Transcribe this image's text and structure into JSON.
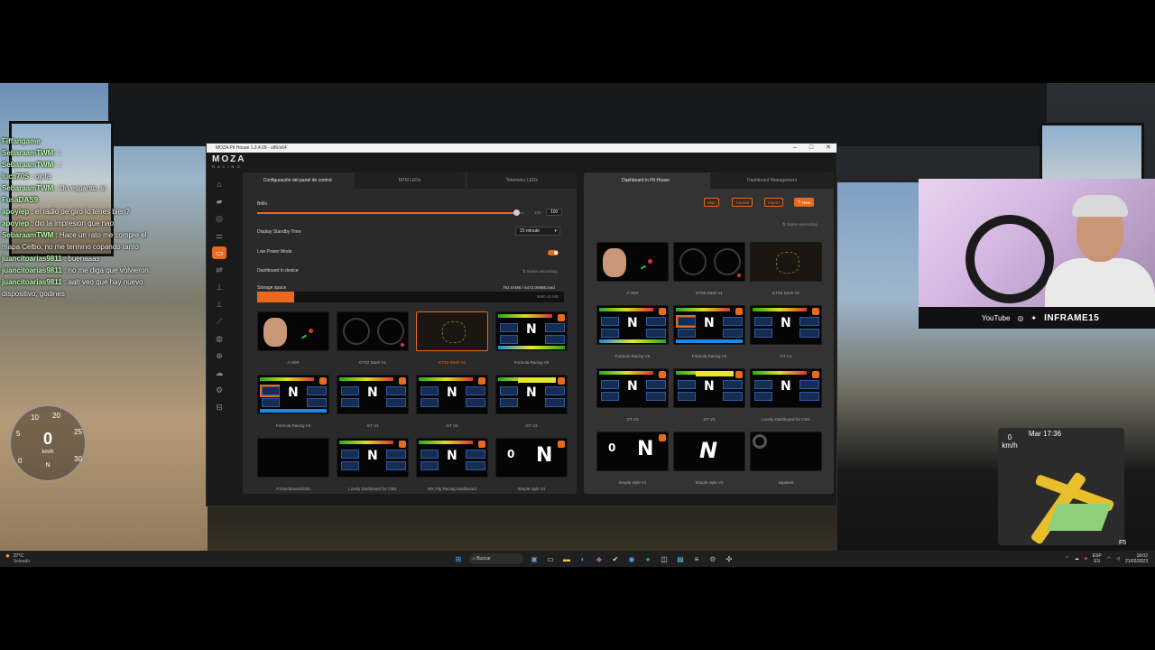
{
  "stream": {
    "chat": [
      {
        "user": "Fiffangame",
        "text": ""
      },
      {
        "user": "SebaraamTWM",
        "text": ": :"
      },
      {
        "user": "SebaraamTWM",
        "text": ": :"
      },
      {
        "user": "luca70S",
        "text": ": ojota"
      },
      {
        "user": "SebaraamTWM",
        "text": ": Un espanto, si"
      },
      {
        "user": "FusaDAS9",
        "text": ""
      },
      {
        "user": "apoyiep",
        "text": ": el radio de giro lo tenes bien?"
      },
      {
        "user": "apoyiep",
        "text": ": dio la impresion que nao"
      },
      {
        "user": "SebaraamTWM",
        "text": ": Hace un rato me compre el mapa Celbo, no me termino copando tanto"
      },
      {
        "user": "juancitoarias9811",
        "text": ": buenaaas"
      },
      {
        "user": "juancitoarias9811",
        "text": ": no me diga que volvieron"
      },
      {
        "user": "juancitoarias9811",
        "text": ": aah veo que hay nuevo dispositivo, godines"
      }
    ],
    "webcam_brand": "INFRAME15",
    "webcam_platform": "YouTube",
    "speedo": {
      "speed": "0",
      "unit": "km/h",
      "gear": "N",
      "ticks": [
        "10",
        "20",
        "25",
        "30",
        "5",
        "0"
      ]
    },
    "nav": {
      "clock": "Mar 17:36",
      "speed": "0",
      "unit": "km/h"
    },
    "fps_label": "F5"
  },
  "app": {
    "title": "MOZA Pit House 1.3.4.09 - x86/x64",
    "logo": "MOZA",
    "logo_sub": "RACING",
    "sidebar_icons": [
      "home-icon",
      "wheelbase-icon",
      "steering-wheel-icon",
      "pedals-icon",
      "dashboard-icon",
      "shifter-icon",
      "handbrake-icon",
      "gear-stick-icon",
      "pedal-icon",
      "wheel-settings-icon",
      "hub-icon",
      "cloud-icon",
      "settings-icon",
      "profile-icon"
    ],
    "left_tabs": [
      "Configuración del panel de control",
      "RPM LEDs",
      "Telemetry LEDs"
    ],
    "right_tabs": [
      "Dashboard in Pit House",
      "Dashboard Management"
    ],
    "brightness": {
      "label": "Brillo",
      "value": "100",
      "max": "100",
      "fraction": 0.97
    },
    "standby": {
      "label": "Display Standby Time",
      "value": "15 minute"
    },
    "low_power": {
      "label": "Low Power Mode",
      "on": true
    },
    "dashboard_in_device": {
      "label": "Dashboard in device",
      "sort": "Name ascending"
    },
    "storage": {
      "label": "Storage space",
      "used": "792.54MB / 6473.00MBUsed",
      "free": "5680.46 MB",
      "fraction": 0.12
    },
    "device_dashboards": [
      {
        "name": "A VER",
        "kind": "face",
        "badge": false,
        "selected": false
      },
      {
        "name": "ETS2 Dash V1",
        "kind": "gauges",
        "badge": false,
        "selected": false
      },
      {
        "name": "ETS2 Dash V2",
        "kind": "map",
        "badge": false,
        "selected": true
      },
      {
        "name": "Formula Racing V5",
        "kind": "formula",
        "badge": true,
        "selected": false
      },
      {
        "name": "Formula Racing V6",
        "kind": "formula6",
        "badge": true,
        "selected": false
      },
      {
        "name": "GT V1",
        "kind": "gt",
        "badge": true,
        "selected": false
      },
      {
        "name": "GT V2",
        "kind": "gt2",
        "badge": true,
        "selected": false
      },
      {
        "name": "GT V3",
        "kind": "gt3",
        "badge": true,
        "selected": false
      },
      {
        "name": "F1Dashboard2020",
        "kind": "blank",
        "badge": false,
        "selected": false
      },
      {
        "name": "Lovely Dashboard for CM1",
        "kind": "gt",
        "badge": true,
        "selected": false
      },
      {
        "name": "MX Flip Racing Dashboard",
        "kind": "gt2",
        "badge": true,
        "selected": false
      },
      {
        "name": "Simple style V1",
        "kind": "simple1",
        "badge": true,
        "selected": false
      }
    ],
    "pit_actions": [
      "Map",
      "Tutorial",
      "Import",
      "New"
    ],
    "pit_sort": "Name ascending",
    "pit_dashboards": [
      {
        "name": "A VER",
        "kind": "face",
        "badge": false
      },
      {
        "name": "ETS2 Dash V1",
        "kind": "gauges",
        "badge": false
      },
      {
        "name": "ETS2 Dash V2",
        "kind": "map",
        "badge": false
      },
      {
        "name": "Formula Racing V5",
        "kind": "formula",
        "badge": true
      },
      {
        "name": "Formula Racing V6",
        "kind": "formula6",
        "badge": true
      },
      {
        "name": "GT V1",
        "kind": "gt",
        "badge": true
      },
      {
        "name": "GT V2",
        "kind": "gt2",
        "badge": true
      },
      {
        "name": "GT V3",
        "kind": "gt3",
        "badge": true
      },
      {
        "name": "Lovely Dashboard for CM1",
        "kind": "gt",
        "badge": true
      },
      {
        "name": "Simple style V1",
        "kind": "simple1",
        "badge": true
      },
      {
        "name": "Simple style V2",
        "kind": "simple2",
        "badge": false
      },
      {
        "name": "sapatest",
        "kind": "sapa",
        "badge": false
      }
    ]
  },
  "taskbar": {
    "weather_temp": "27°C",
    "weather_desc": "Soleado",
    "search": "Buscar",
    "lang": "ESP",
    "lang2": "ES",
    "time": "18:02",
    "date": "21/02/2023"
  }
}
